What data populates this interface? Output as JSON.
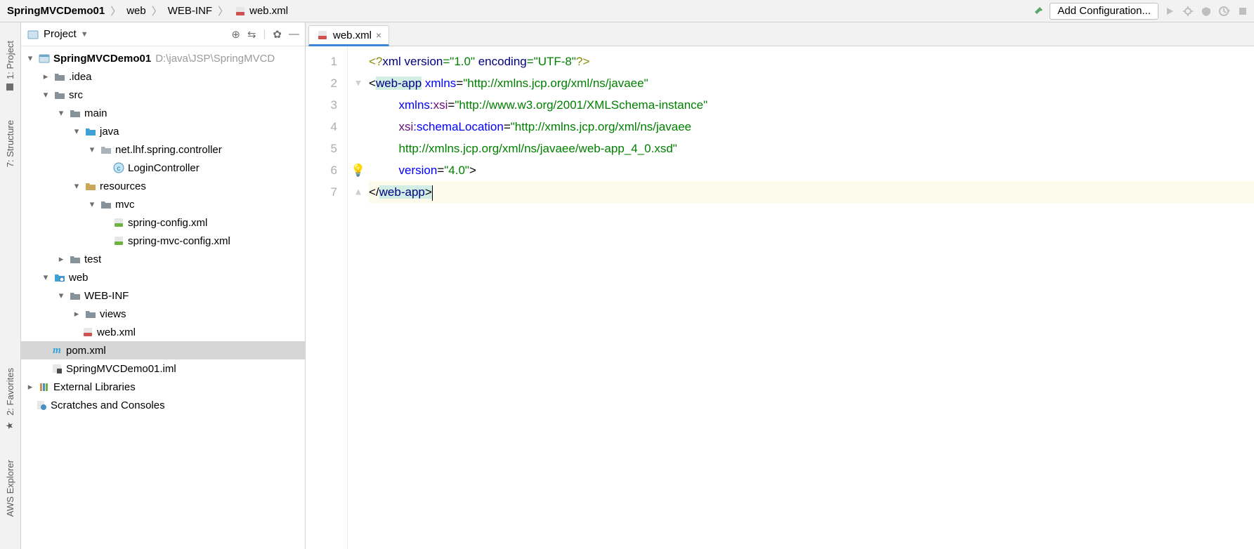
{
  "breadcrumbs": [
    "SpringMVCDemo01",
    "web",
    "WEB-INF",
    "web.xml"
  ],
  "addConfig": "Add Configuration...",
  "leftRail": {
    "project": "1: Project",
    "structure": "7: Structure",
    "favorites": "2: Favorites",
    "aws": "AWS Explorer"
  },
  "projectPane": {
    "title": "Project",
    "rootName": "SpringMVCDemo01",
    "rootPath": "D:\\java\\JSP\\SpringMVCD",
    "nodes": {
      "idea": ".idea",
      "src": "src",
      "main": "main",
      "java": "java",
      "pkg": "net.lhf.spring.controller",
      "class": "LoginController",
      "resources": "resources",
      "mvc": "mvc",
      "xml1": "spring-config.xml",
      "xml2": "spring-mvc-config.xml",
      "test": "test",
      "web": "web",
      "webinf": "WEB-INF",
      "views": "views",
      "webxml": "web.xml",
      "pom": "pom.xml",
      "iml": "SpringMVCDemo01.iml",
      "extlib": "External Libraries",
      "scratch": "Scratches and Consoles"
    }
  },
  "tab": {
    "name": "web.xml"
  },
  "code": {
    "lineNumbers": [
      "1",
      "2",
      "3",
      "4",
      "5",
      "6",
      "7"
    ],
    "l1a": "<?",
    "l1b": "xml version",
    "l1c": "=\"1.0\"",
    "l1d": " encoding",
    "l1e": "=\"UTF-8\"",
    "l1f": "?>",
    "l2a": "<",
    "l2t": "web-app",
    "l2b": " ",
    "l2c": "xmlns",
    "l2d": "=",
    "l2e": "\"http://xmlns.jcp.org/xml/ns/javaee\"",
    "l3a": "         ",
    "l3b": "xmlns:",
    "l3c": "xsi",
    "l3d": "=",
    "l3e": "\"http://www.w3.org/2001/XMLSchema-instance\"",
    "l4a": "         ",
    "l4b": "xsi",
    "l4c": ":schemaLocation",
    "l4d": "=",
    "l4e": "\"http://xmlns.jcp.org/xml/ns/javaee",
    "l5a": "         ",
    "l5b": "http://xmlns.jcp.org/xml/ns/javaee/web-app_4_0.xsd\"",
    "l6a": "         ",
    "l6b": "version",
    "l6c": "=",
    "l6d": "\"4.0\"",
    "l6e": ">",
    "l7a": "</",
    "l7b": "web-app",
    "l7c": ">"
  }
}
